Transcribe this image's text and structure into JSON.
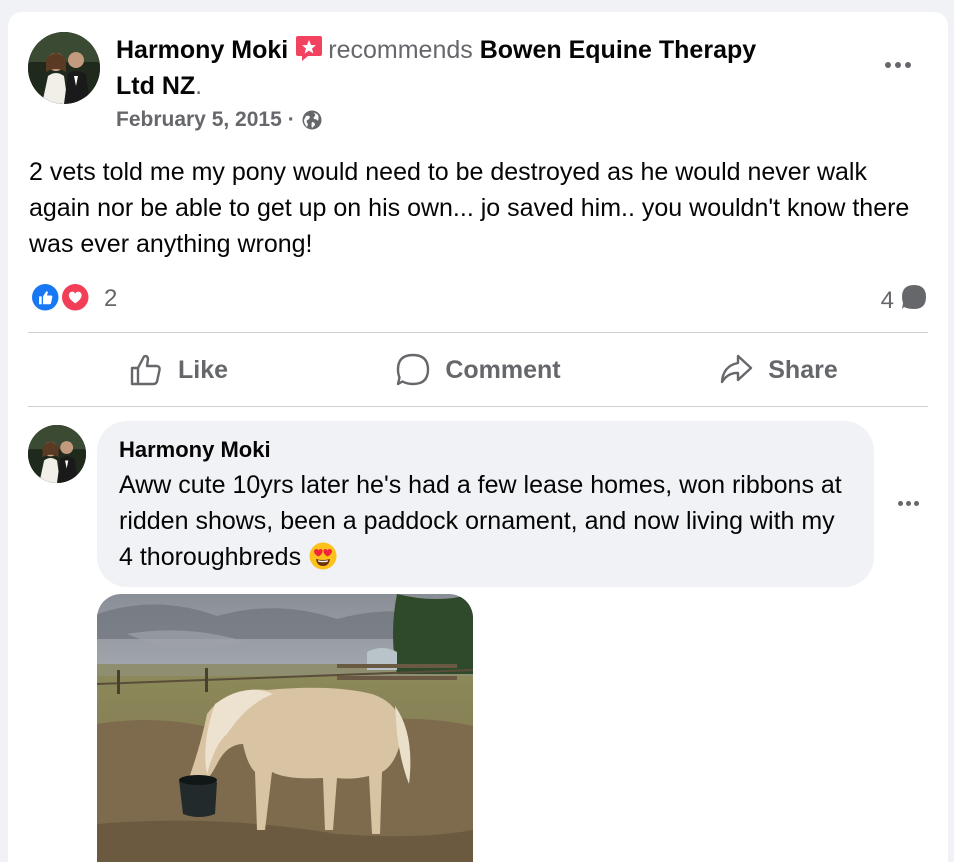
{
  "post": {
    "author": "Harmony Moki",
    "action_text": "recommends",
    "page_name": "Bowen Equine Therapy Ltd NZ",
    "page_suffix": ".",
    "date": "February 5, 2015",
    "separator": "·",
    "audience_icon": "globe-icon",
    "text": "2 vets told me my pony would need to be destroyed as he would never walk again nor be able to get up on his own... jo saved him.. you wouldn't know there was ever anything wrong!",
    "reaction_count": "2",
    "comment_count": "4",
    "recommend_badge_color": "#f3425f"
  },
  "actions": {
    "like": "Like",
    "comment": "Comment",
    "share": "Share"
  },
  "comment": {
    "author": "Harmony Moki",
    "text": "Aww cute 10yrs later he's had a few lease homes, won ribbons at ridden shows, been a paddock ornament, and now living with my 4 thoroughbreds",
    "emoji": "heart-eyes-emoji"
  },
  "colors": {
    "like_blue": "#1877f2",
    "love_red": "#f33e58",
    "secondary_text": "#65676b",
    "bubble_bg": "#f0f2f5"
  }
}
